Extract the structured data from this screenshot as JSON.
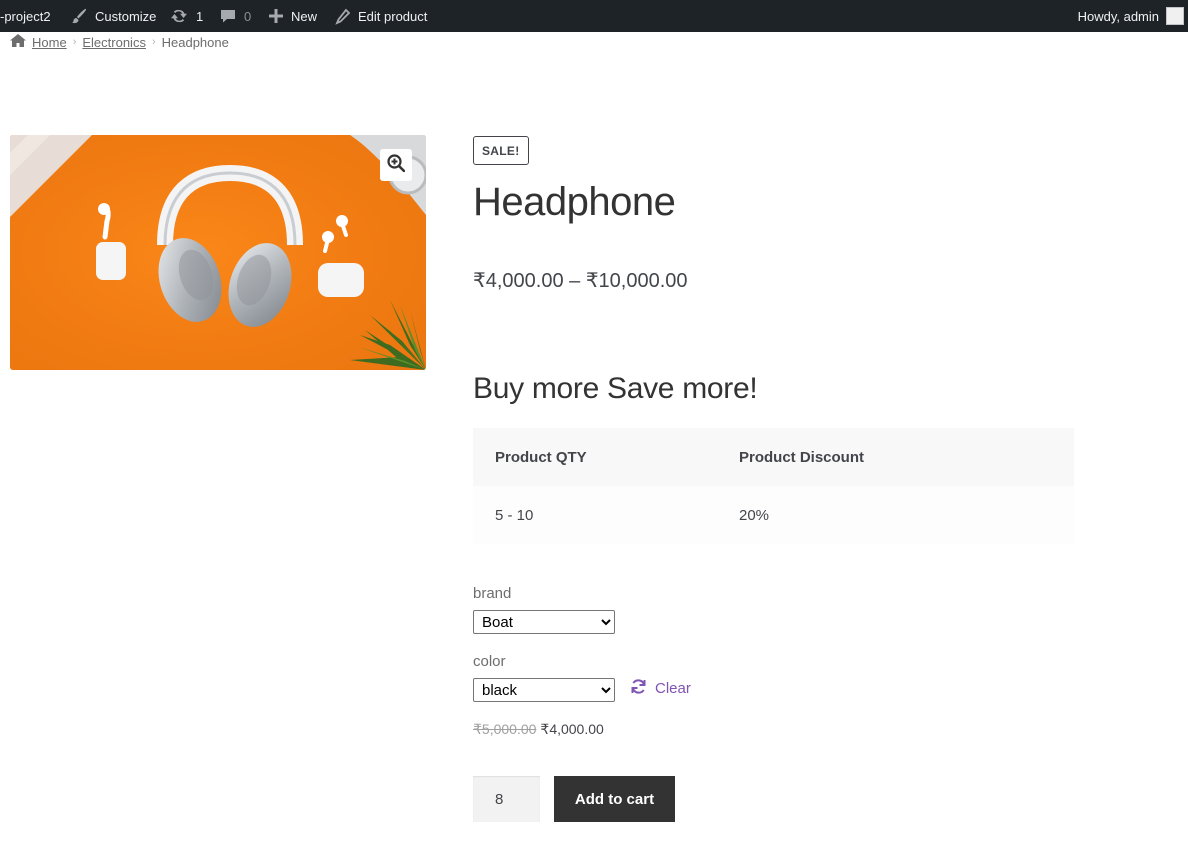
{
  "adminbar": {
    "site_name": "-project2",
    "customize": "Customize",
    "updates_count": "1",
    "comments_count": "0",
    "new": "New",
    "edit_product": "Edit product",
    "howdy": "Howdy, admin"
  },
  "breadcrumb": {
    "home": "Home",
    "category": "Electronics",
    "current": "Headphone"
  },
  "product": {
    "image_alt": "Headphone",
    "sale_badge": "SALE!",
    "title": "Headphone",
    "price_range": "₹4,000.00 – ₹10,000.00"
  },
  "discount": {
    "heading": "Buy more Save more!",
    "headers": [
      "Product QTY",
      "Product Discount"
    ],
    "rows": [
      [
        "5 - 10",
        "20%"
      ]
    ]
  },
  "variations": {
    "brand_label": "brand",
    "brand_value": "Boat",
    "color_label": "color",
    "color_value": "black",
    "clear": "Clear"
  },
  "variation_price": {
    "old": "₹5,000.00",
    "new": "₹4,000.00"
  },
  "cart": {
    "quantity": "8",
    "add_to_cart": "Add to cart"
  },
  "colors": {
    "adminbar_bg": "#1d2327",
    "button_bg": "#333333",
    "link_purple": "#7f54b3",
    "image_orange": "#f57f17"
  },
  "icons": {
    "breadcrumb_home": "home-icon",
    "zoom": "zoom-in-icon",
    "clear": "refresh-icon"
  }
}
